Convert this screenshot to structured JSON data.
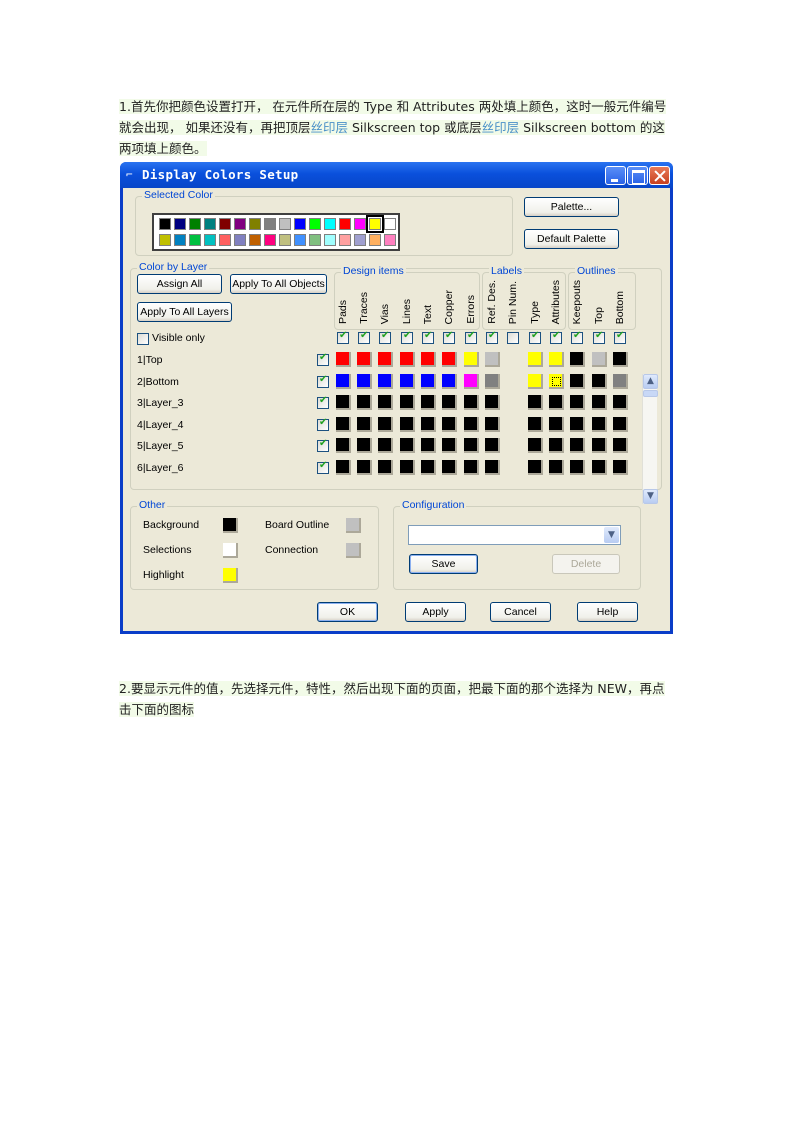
{
  "doc": {
    "para1": {
      "prefix": "1.",
      "text_a": "首先你把颜色设置打开， 在元件所在层的 Type 和 Attributes 两处填上颜色，这时一般元件编号就会出现， 如果还没有，再把顶层",
      "link1": "丝印层",
      "text_b": " Silkscreen top 或底层",
      "link2": "丝印层",
      "text_c": " Silkscreen bottom 的这两项填上颜色。"
    },
    "para2": {
      "prefix": "2.",
      "text": "要显示元件的值，先选择元件，特性，然后出现下面的页面，把最下面的那个选择为 NEW，再点击下面的图标"
    }
  },
  "dialog": {
    "title": "Display Colors Setup",
    "title_icon": "pcb-app-icon",
    "titlebar_buttons": {
      "minimize": "minimize-icon",
      "maximize": "maximize-icon",
      "close": "close-icon"
    },
    "selected_color": {
      "label": "Selected Color",
      "palette_row1": [
        "#000000",
        "#000080",
        "#008000",
        "#008080",
        "#800000",
        "#800080",
        "#808000",
        "#808080",
        "#c0c0c0",
        "#0000ff",
        "#00ff00",
        "#00ffff",
        "#ff0000",
        "#ff00ff",
        "#ffff00",
        "#ffffff"
      ],
      "palette_row2": [
        "#c0c000",
        "#0080c0",
        "#00c040",
        "#00c0c0",
        "#ff6060",
        "#8080c0",
        "#c06000",
        "#ff0080",
        "#c0c080",
        "#4090ff",
        "#80c080",
        "#a0ffff",
        "#ffa0a0",
        "#a0a0d0",
        "#ffb060",
        "#ff80c0"
      ],
      "selected_index": 14,
      "palette_button": "Palette...",
      "default_palette_button": "Default Palette"
    },
    "color_by_layer": {
      "label": "Color by Layer",
      "assign_all": "Assign All",
      "apply_to_all_objects": "Apply To All Objects",
      "apply_to_all_layers": "Apply To All Layers",
      "visible_only": {
        "label": "Visible only",
        "checked": false
      },
      "groups": [
        {
          "label": "Design items",
          "columns": [
            "Pads",
            "Traces",
            "Vias",
            "Lines",
            "Text",
            "Copper",
            "Errors"
          ]
        },
        {
          "label": "Labels",
          "columns": [
            "Ref. Des.",
            "Pin Num.",
            "Type",
            "Attributes"
          ]
        },
        {
          "label": "Outlines",
          "columns": [
            "Keepouts",
            "Top",
            "Bottom"
          ]
        }
      ],
      "column_enabled": [
        true,
        true,
        true,
        true,
        true,
        true,
        true,
        true,
        false,
        true,
        true,
        true,
        true,
        true
      ],
      "layers": [
        {
          "name": "1|Top",
          "enabled": true,
          "colors": [
            "#ff0000",
            "#ff0000",
            "#ff0000",
            "#ff0000",
            "#ff0000",
            "#ff0000",
            "#ffff00",
            "#c0c0c0",
            null,
            "#ffff00",
            "#ffff00",
            "#000000",
            "#c0c0c0",
            "#000000"
          ]
        },
        {
          "name": "2|Bottom",
          "enabled": true,
          "colors": [
            "#0000ff",
            "#0000ff",
            "#0000ff",
            "#0000ff",
            "#0000ff",
            "#0000ff",
            "#ff00ff",
            "#808080",
            null,
            "#ffff00",
            "#ffff00",
            "#000000",
            "#000000",
            "#808080"
          ]
        },
        {
          "name": "3|Layer_3",
          "enabled": true,
          "colors": [
            "#000000",
            "#000000",
            "#000000",
            "#000000",
            "#000000",
            "#000000",
            "#000000",
            "#000000",
            null,
            "#000000",
            "#000000",
            "#000000",
            "#000000",
            "#000000"
          ]
        },
        {
          "name": "4|Layer_4",
          "enabled": true,
          "colors": [
            "#000000",
            "#000000",
            "#000000",
            "#000000",
            "#000000",
            "#000000",
            "#000000",
            "#000000",
            null,
            "#000000",
            "#000000",
            "#000000",
            "#000000",
            "#000000"
          ]
        },
        {
          "name": "5|Layer_5",
          "enabled": true,
          "colors": [
            "#000000",
            "#000000",
            "#000000",
            "#000000",
            "#000000",
            "#000000",
            "#000000",
            "#000000",
            null,
            "#000000",
            "#000000",
            "#000000",
            "#000000",
            "#000000"
          ]
        },
        {
          "name": "6|Layer_6",
          "enabled": true,
          "colors": [
            "#000000",
            "#000000",
            "#000000",
            "#000000",
            "#000000",
            "#000000",
            "#000000",
            "#000000",
            null,
            "#000000",
            "#000000",
            "#000000",
            "#000000",
            "#000000"
          ]
        }
      ],
      "focused_cell": {
        "layer": 1,
        "column": 10
      },
      "scroll_up": "scroll-up-icon",
      "scroll_down": "scroll-down-icon"
    },
    "other": {
      "label": "Other",
      "items": [
        {
          "label": "Background",
          "color": "#000000"
        },
        {
          "label": "Selections",
          "color": "#ffffff"
        },
        {
          "label": "Highlight",
          "color": "#ffff00"
        },
        {
          "label": "Board Outline",
          "color": "#c0c0c0"
        },
        {
          "label": "Connection",
          "color": "#c0c0c0"
        }
      ]
    },
    "configuration": {
      "label": "Configuration",
      "selected": "",
      "save": "Save",
      "delete": "Delete"
    },
    "footer": {
      "ok": "OK",
      "apply": "Apply",
      "cancel": "Cancel",
      "help": "Help"
    }
  }
}
